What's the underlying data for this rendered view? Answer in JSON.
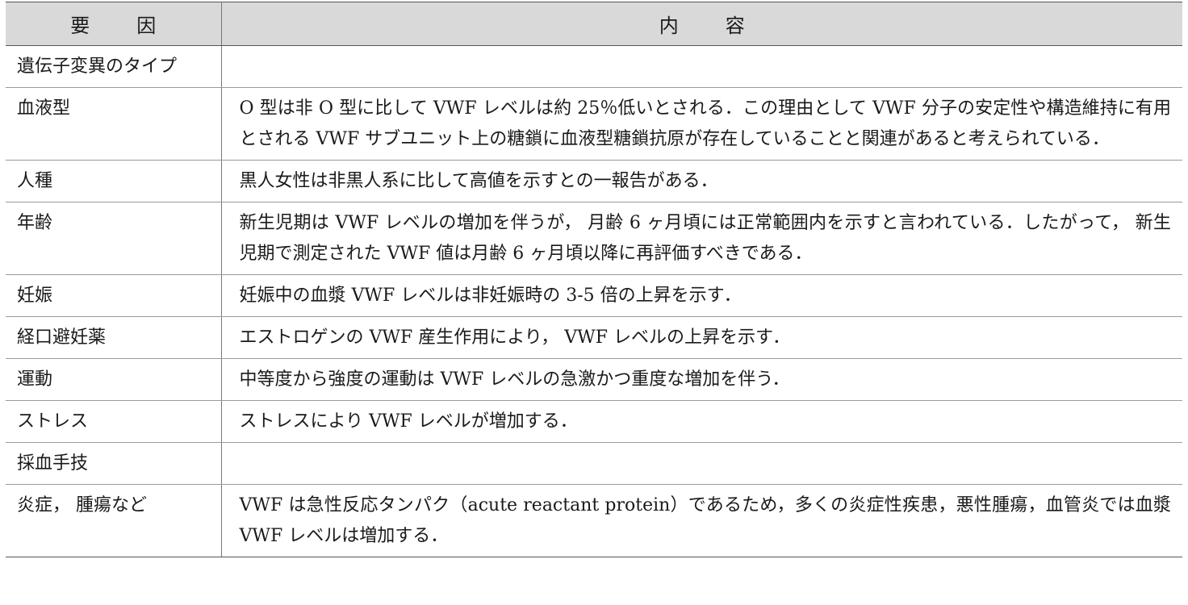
{
  "header": {
    "col_factor": "要 因",
    "col_content": "内 容"
  },
  "rows": [
    {
      "factor": "遺伝子変異のタイプ",
      "content": ""
    },
    {
      "factor": "血液型",
      "content": "O 型は非 O 型に比して VWF レベルは約 25％低いとされる．この理由として VWF 分子の安定性や構造維持に有用とされる VWF サブユニット上の糖鎖に血液型糖鎖抗原が存在していることと関連があると考えられている．"
    },
    {
      "factor": "人種",
      "content": "黒人女性は非黒人系に比して高値を示すとの一報告がある．"
    },
    {
      "factor": "年齢",
      "content": "新生児期は VWF レベルの増加を伴うが， 月齢 6 ヶ月頃には正常範囲内を示すと言われている．したがって， 新生児期で測定された VWF 値は月齢 6 ヶ月頃以降に再評価すべきである．"
    },
    {
      "factor": "妊娠",
      "content": "妊娠中の血漿 VWF レベルは非妊娠時の 3-5 倍の上昇を示す．"
    },
    {
      "factor": "経口避妊薬",
      "content": "エストロゲンの VWF 産生作用により， VWF レベルの上昇を示す．"
    },
    {
      "factor": "運動",
      "content": "中等度から強度の運動は VWF レベルの急激かつ重度な増加を伴う．"
    },
    {
      "factor": "ストレス",
      "content": "ストレスにより VWF レベルが増加する．"
    },
    {
      "factor": "採血手技",
      "content": ""
    },
    {
      "factor": "炎症， 腫瘍など",
      "content": "VWF は急性反応タンパク（acute reactant protein）であるため，多くの炎症性疾患，悪性腫瘍，血管炎では血漿 VWF レベルは増加する．"
    }
  ]
}
